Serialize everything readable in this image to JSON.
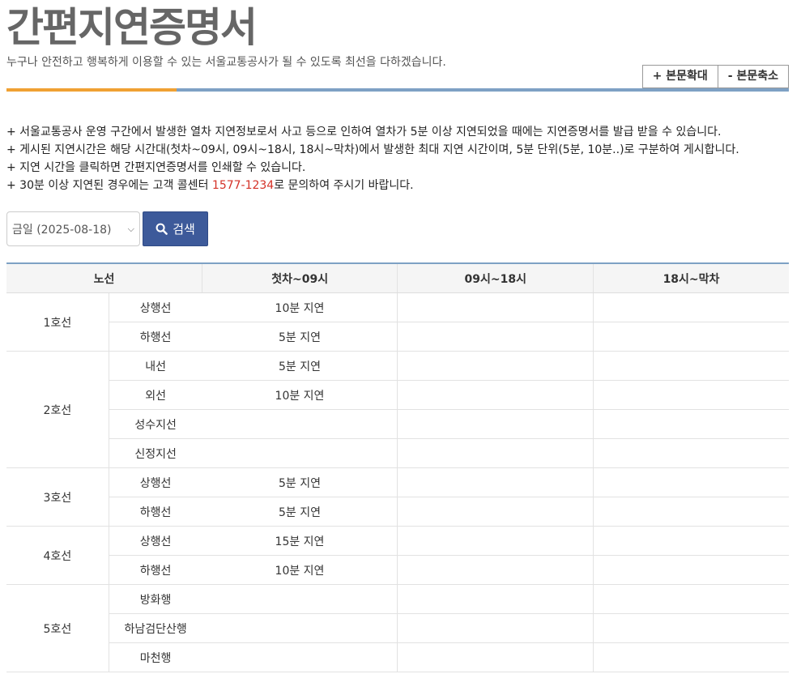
{
  "page": {
    "title": "간편지연증명서",
    "subtitle": "누구나 안전하고 행복하게 이용할 수 있는 서울교통공사가 될 수 있도록 최선을 다하겠습니다."
  },
  "toolbar": {
    "zoom_in_label": "+ 본문확대",
    "zoom_out_label": "- 본문축소"
  },
  "notices": {
    "line1": "+ 서울교통공사 운영 구간에서 발생한 열차 지연정보로서 사고 등으로 인하여 열차가 5분 이상 지연되었을 때에는 지연증명서를 발급 받을 수 있습니다.",
    "line2": "+ 게시된 지연시간은 해당 시간대(첫차~09시, 09시~18시, 18시~막차)에서 발생한 최대 지연 시간이며, 5분 단위(5분, 10분..)로 구분하여 게시합니다.",
    "line3": "+ 지연 시간을 클릭하면 간편지연증명서를 인쇄할 수 있습니다.",
    "line4_before": "+ 30분 이상 지연된 경우에는 고객 콜센터 ",
    "line4_phone": "1577-1234",
    "line4_after": "로 문의하여 주시기 바랍니다."
  },
  "search": {
    "date_selected": "금일 (2025-08-18)",
    "button_label": "검색"
  },
  "table": {
    "headers": {
      "line": "노선",
      "t1": "첫차~09시",
      "t2": "09시~18시",
      "t3": "18시~막차"
    },
    "groups": [
      {
        "line": "1호선",
        "rows": [
          {
            "dir": "상행선",
            "t1": "10분 지연",
            "t2": "",
            "t3": ""
          },
          {
            "dir": "하행선",
            "t1": "5분 지연",
            "t2": "",
            "t3": ""
          }
        ]
      },
      {
        "line": "2호선",
        "rows": [
          {
            "dir": "내선",
            "t1": "5분 지연",
            "t2": "",
            "t3": ""
          },
          {
            "dir": "외선",
            "t1": "10분 지연",
            "t2": "",
            "t3": ""
          },
          {
            "dir": "성수지선",
            "t1": "",
            "t2": "",
            "t3": ""
          },
          {
            "dir": "신정지선",
            "t1": "",
            "t2": "",
            "t3": ""
          }
        ]
      },
      {
        "line": "3호선",
        "rows": [
          {
            "dir": "상행선",
            "t1": "5분 지연",
            "t2": "",
            "t3": ""
          },
          {
            "dir": "하행선",
            "t1": "5분 지연",
            "t2": "",
            "t3": ""
          }
        ]
      },
      {
        "line": "4호선",
        "rows": [
          {
            "dir": "상행선",
            "t1": "15분 지연",
            "t2": "",
            "t3": ""
          },
          {
            "dir": "하행선",
            "t1": "10분 지연",
            "t2": "",
            "t3": ""
          }
        ]
      },
      {
        "line": "5호선",
        "rows": [
          {
            "dir": "방화행",
            "t1": "",
            "t2": "",
            "t3": ""
          },
          {
            "dir": "하남검단산행",
            "t1": "",
            "t2": "",
            "t3": ""
          },
          {
            "dir": "마천행",
            "t1": "",
            "t2": "",
            "t3": ""
          }
        ]
      }
    ]
  },
  "colors": {
    "accent_orange": "#f0a133",
    "accent_blue": "#7ea1c4",
    "button_blue": "#3d5a9a",
    "phone_red": "#d43127"
  }
}
